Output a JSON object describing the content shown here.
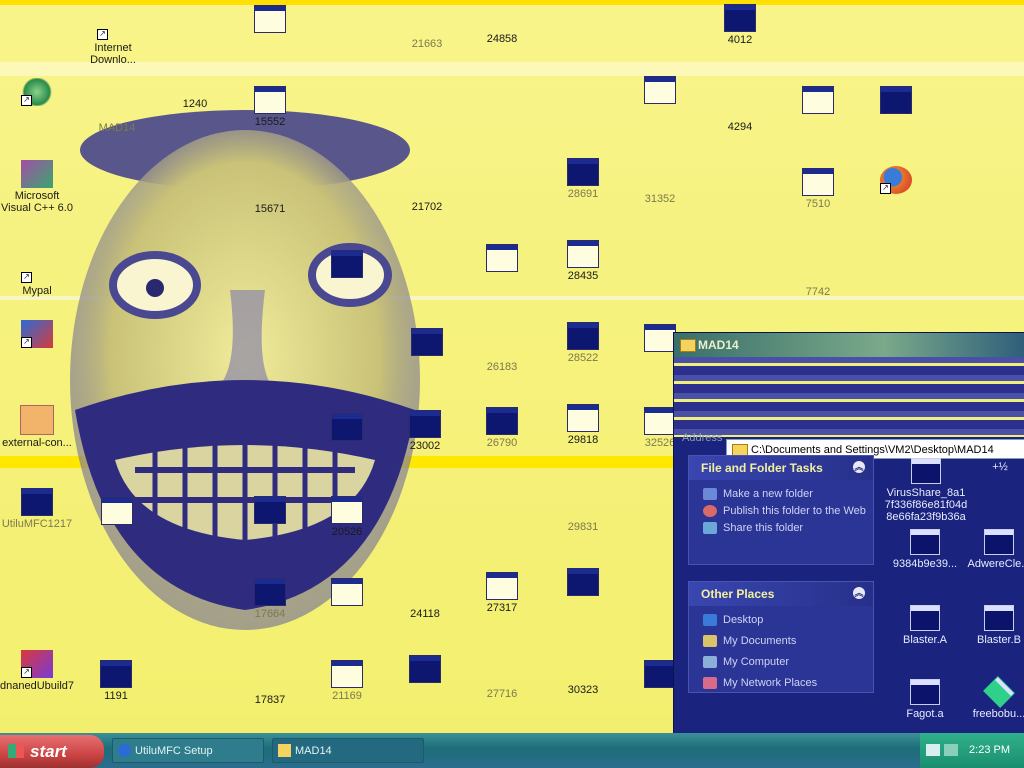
{
  "desktop": {
    "icons": [
      {
        "label": "Internet\nDownlo...",
        "type": "shortcut"
      },
      {
        "label": "MAD14",
        "type": "app"
      },
      {
        "label": "Microsoft Visual C++ 6.0",
        "type": "shortcut"
      },
      {
        "label": "Mypal",
        "type": "shortcut"
      },
      {
        "label": "",
        "type": "shortcut"
      },
      {
        "label": "external-con...",
        "type": "file"
      },
      {
        "label": "UtiluMFC1217",
        "type": "app"
      },
      {
        "label": "dnanedUbuild7",
        "type": "shortcut"
      },
      {
        "label": "1240",
        "type": "window"
      },
      {
        "label": "15552",
        "type": "window"
      },
      {
        "label": "15671",
        "type": "window"
      },
      {
        "label": "20526",
        "type": "window"
      },
      {
        "label": "17664",
        "type": "window"
      },
      {
        "label": "17837",
        "type": "window"
      },
      {
        "label": "1191",
        "type": "window"
      },
      {
        "label": "21663",
        "type": "window"
      },
      {
        "label": "24858",
        "type": "window"
      },
      {
        "label": "21702",
        "type": "window"
      },
      {
        "label": "26183",
        "type": "window"
      },
      {
        "label": "23002",
        "type": "window"
      },
      {
        "label": "26790",
        "type": "window"
      },
      {
        "label": "24118",
        "type": "window"
      },
      {
        "label": "27317",
        "type": "window"
      },
      {
        "label": "21169",
        "type": "window"
      },
      {
        "label": "27716",
        "type": "window"
      },
      {
        "label": "28691",
        "type": "window"
      },
      {
        "label": "28435",
        "type": "window"
      },
      {
        "label": "28522",
        "type": "window"
      },
      {
        "label": "29818",
        "type": "window"
      },
      {
        "label": "29831",
        "type": "window"
      },
      {
        "label": "30323",
        "type": "window"
      },
      {
        "label": "31352",
        "type": "window"
      },
      {
        "label": "32526",
        "type": "window"
      },
      {
        "label": "4012",
        "type": "window"
      },
      {
        "label": "4294",
        "type": "window"
      },
      {
        "label": "7510",
        "type": "window"
      },
      {
        "label": "7742",
        "type": "window"
      }
    ]
  },
  "explorer": {
    "title": "MAD14",
    "address_label": "Address",
    "address": "C:\\Documents and Settings\\VM2\\Desktop\\MAD14",
    "tasks_panel": {
      "title": "File and Folder Tasks",
      "items": [
        "Make a new folder",
        "Publish this folder to the Web",
        "Share this folder"
      ]
    },
    "places_panel": {
      "title": "Other Places",
      "items": [
        "Desktop",
        "My Documents",
        "My Computer",
        "My Network Places"
      ]
    },
    "files": [
      {
        "label": "VirusShare_8a17f336f86e81f04d8e66fa23f9b36a"
      },
      {
        "label": "+½"
      },
      {
        "label": "9384b9e39..."
      },
      {
        "label": "AdwereCle..."
      },
      {
        "label": "Blaster.A"
      },
      {
        "label": "Blaster.B"
      },
      {
        "label": "Fagot.a"
      },
      {
        "label": "freebobu..."
      }
    ]
  },
  "taskbar": {
    "start_label": "start",
    "buttons": [
      {
        "label": "UtiluMFC Setup"
      },
      {
        "label": "MAD14"
      }
    ],
    "clock": "2:23 PM"
  },
  "colors": {
    "desktop_bg": "#f6f27e",
    "explorer_bg": "#1a237e",
    "taskbar": "#2b7d8c",
    "start": "#cc4444"
  }
}
